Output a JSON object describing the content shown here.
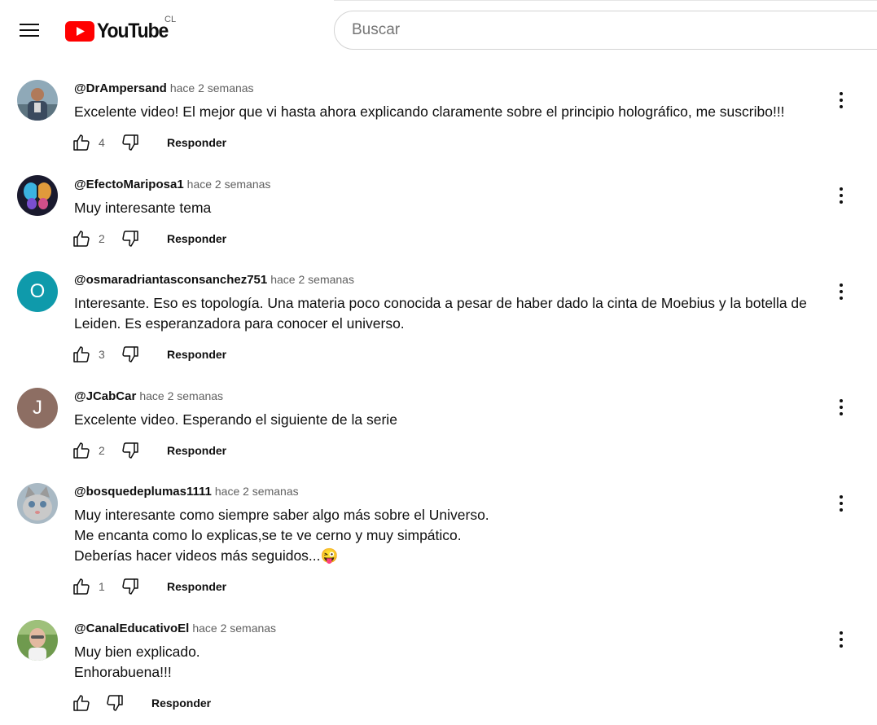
{
  "header": {
    "logo_text": "YouTube",
    "country_code": "CL",
    "search_placeholder": "Buscar",
    "icons": [
      "hamburger-menu-icon",
      "youtube-logo-icon"
    ]
  },
  "reply_label": "Responder",
  "comments": [
    {
      "author": "@DrAmpersand",
      "time": "hace 2 semanas",
      "text": "Excelente video! El mejor que vi hasta ahora explicando claramente sobre el principio holográfico, me suscribo!!!",
      "likes": "4",
      "avatar_type": "photo"
    },
    {
      "author": "@EfectoMariposa1",
      "time": "hace 2 semanas",
      "text": "Muy interesante tema",
      "likes": "2",
      "avatar_type": "photo"
    },
    {
      "author": "@osmaradriantasconsanchez751",
      "time": "hace 2 semanas",
      "text": "Interesante. Eso es topología. Una materia poco conocida a pesar de haber dado la cinta de Moebius y la botella de\nLeiden. Es esperanzadora para conocer el universo.",
      "likes": "3",
      "avatar_type": "letter",
      "avatar_letter": "O",
      "avatar_color": "#0f9aab"
    },
    {
      "author": "@JCabCar",
      "time": "hace 2 semanas",
      "text": "Excelente video. Esperando el siguiente de la serie",
      "likes": "2",
      "avatar_type": "letter",
      "avatar_letter": "J",
      "avatar_color": "#8d6e63"
    },
    {
      "author": "@bosquedeplumas1111",
      "time": "hace 2 semanas",
      "text": "Muy interesante como siempre saber algo más sobre el Universo.\nMe encanta como lo explicas,se te ve cerno y muy simpático.\nDeberías hacer videos más seguidos...😜",
      "likes": "1",
      "avatar_type": "photo"
    },
    {
      "author": "@CanalEducativoEl",
      "time": "hace 2 semanas",
      "text": "Muy bien explicado.\nEnhorabuena!!!",
      "likes": "",
      "avatar_type": "photo"
    }
  ]
}
